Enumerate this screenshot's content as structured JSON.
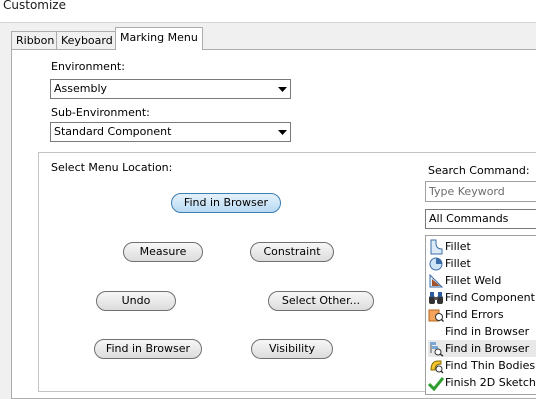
{
  "window": {
    "title": "Customize"
  },
  "tabs": [
    {
      "label": "Ribbon"
    },
    {
      "label": "Keyboard"
    },
    {
      "label": "Marking Menu"
    }
  ],
  "environment": {
    "label": "Environment:",
    "value": "Assembly"
  },
  "sub_environment": {
    "label": "Sub-Environment:",
    "value": "Standard Component"
  },
  "menu_location": {
    "label": "Select Menu Location:",
    "buttons": {
      "north": "Find in Browser",
      "northwest": "Measure",
      "northeast": "Constraint",
      "west": "Undo",
      "east": "Select Other...",
      "southwest": "Find in Browser",
      "southeast": "Visibility"
    }
  },
  "search": {
    "label": "Search Command:",
    "placeholder": "Type Keyword",
    "filter_value": "All Commands"
  },
  "commands": [
    {
      "label": "Fillet",
      "icon": "fillet-icon"
    },
    {
      "label": "Fillet",
      "icon": "fillet-variant-icon"
    },
    {
      "label": "Fillet Weld",
      "icon": "fillet-weld-icon"
    },
    {
      "label": "Find Component",
      "icon": "binoculars-icon"
    },
    {
      "label": "Find Errors",
      "icon": "find-errors-icon"
    },
    {
      "label": "Find in Browser",
      "icon": ""
    },
    {
      "label": "Find in Browser",
      "icon": "find-in-browser-icon",
      "selected": true
    },
    {
      "label": "Find Thin Bodies",
      "icon": "thin-bodies-icon"
    },
    {
      "label": "Finish 2D Sketch",
      "icon": "checkmark-icon"
    }
  ]
}
